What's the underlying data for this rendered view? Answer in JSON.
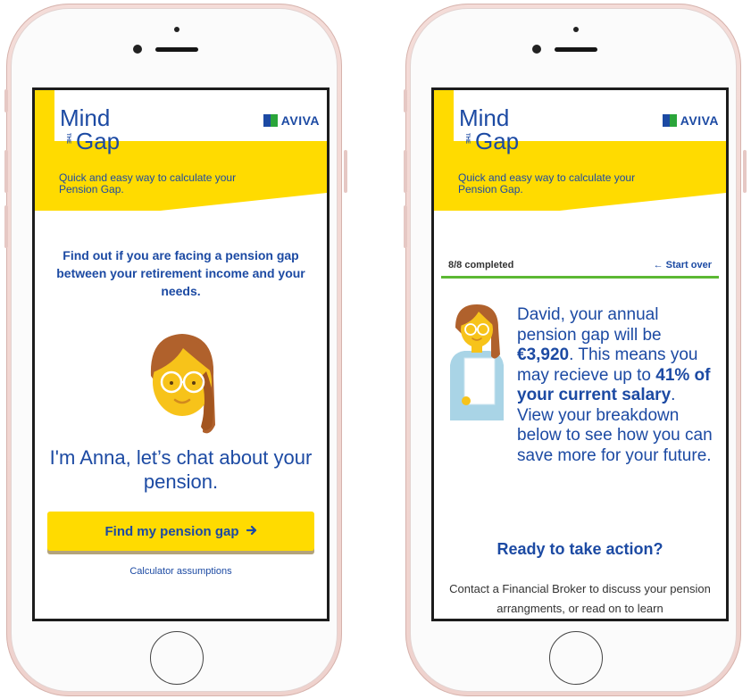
{
  "brand": {
    "mind": "Mind",
    "the": "THE",
    "gap": "Gap",
    "aviva": "AVIVA",
    "tagline": "Quick and easy way to calculate your Pension Gap."
  },
  "left_screen": {
    "intro": "Find out if you are facing a pension gap between your retirement income and your needs.",
    "chat": "I'm Anna, let’s chat about your pension.",
    "cta_label": "Find my pension gap",
    "cta_icon": "arrow-right-icon",
    "assumptions_link": "Calculator assumptions"
  },
  "right_screen": {
    "progress_label": "8/8 completed",
    "progress_fraction": 1.0,
    "start_over": "Start over",
    "start_over_icon": "arrow-left-icon",
    "result_pre": "David, your annual pension gap will be ",
    "gap_amount": "€3,920",
    "result_mid": ". This means you may recieve up to ",
    "salary_pct": "41% of your current salary",
    "result_post": ". View your breakdown below to see how you can save more for your future.",
    "ready_heading": "Ready to take action?",
    "contact_text": "Contact a Financial Broker to discuss your pension arrangments, or read on to learn"
  },
  "colors": {
    "brand_yellow": "#ffdb00",
    "brand_blue": "#1c4aa3",
    "progress_green": "#5cb833",
    "phone_rose": "#efd2cd"
  }
}
